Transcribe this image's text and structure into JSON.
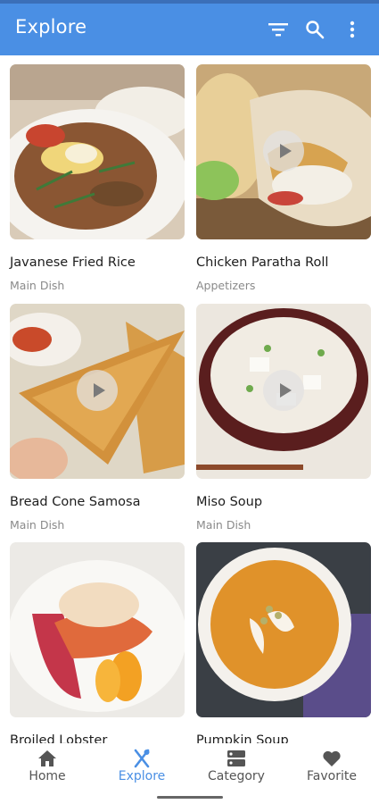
{
  "app_bar": {
    "title": "Explore",
    "background": "#4a8fe4",
    "actions": [
      "filter-icon",
      "search-icon",
      "more-vert-icon"
    ]
  },
  "recipes": [
    {
      "name": "Javanese Fried Rice",
      "category": "Main Dish",
      "has_video": false
    },
    {
      "name": "Chicken Paratha Roll",
      "category": "Appetizers",
      "has_video": true
    },
    {
      "name": "Bread Cone Samosa",
      "category": "Main Dish",
      "has_video": true
    },
    {
      "name": "Miso Soup",
      "category": "Main Dish",
      "has_video": true
    },
    {
      "name": "Broiled Lobster",
      "category": "",
      "has_video": false
    },
    {
      "name": "Pumpkin Soup",
      "category": "",
      "has_video": false
    }
  ],
  "bottom_nav": {
    "items": [
      {
        "label": "Home",
        "icon": "home-icon"
      },
      {
        "label": "Explore",
        "icon": "utensils-icon"
      },
      {
        "label": "Category",
        "icon": "category-icon"
      },
      {
        "label": "Favorite",
        "icon": "heart-icon"
      }
    ],
    "active": "Explore",
    "active_color": "#4a8fe4"
  }
}
